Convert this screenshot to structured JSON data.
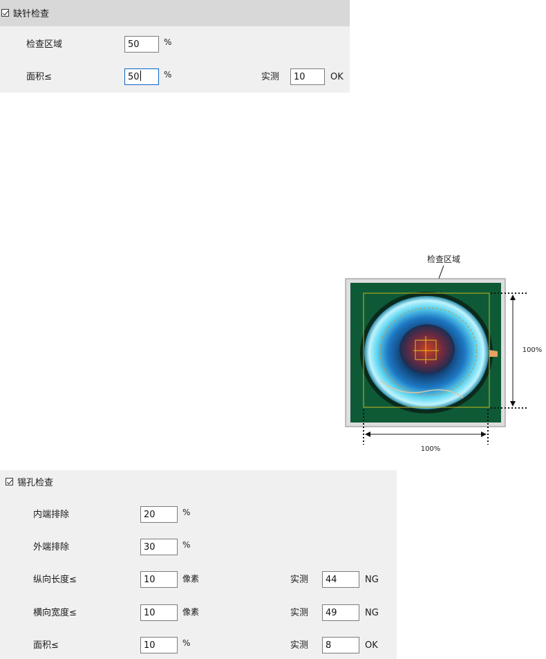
{
  "missing_pin": {
    "title": "缺针检查",
    "checked": true,
    "rows": [
      {
        "label": "检查区域",
        "value": "50",
        "unit": "%"
      },
      {
        "label": "面积≤",
        "value": "50",
        "unit": "%",
        "measured_label": "实测",
        "measured": "10",
        "result": "OK"
      }
    ]
  },
  "diagram": {
    "callout": "检查区域",
    "height_label": "100%",
    "width_label": "100%"
  },
  "solder_hole": {
    "title": "锡孔检查",
    "checked": true,
    "rows": [
      {
        "label": "内端排除",
        "value": "20",
        "unit": "%"
      },
      {
        "label": "外端排除",
        "value": "30",
        "unit": "%"
      },
      {
        "label": "纵向长度≤",
        "value": "10",
        "unit": "像素",
        "measured_label": "实测",
        "measured": "44",
        "result": "NG"
      },
      {
        "label": "横向宽度≤",
        "value": "10",
        "unit": "像素",
        "measured_label": "实测",
        "measured": "49",
        "result": "NG"
      },
      {
        "label": "面积≤",
        "value": "10",
        "unit": "%",
        "measured_label": "实测",
        "measured": "8",
        "result": "OK"
      }
    ]
  },
  "colors": {
    "panel_bg": "#f0f0f0",
    "header_bg": "#d8d8d8",
    "focus_border": "#0a64c8",
    "board_green": "#0e5a36"
  }
}
